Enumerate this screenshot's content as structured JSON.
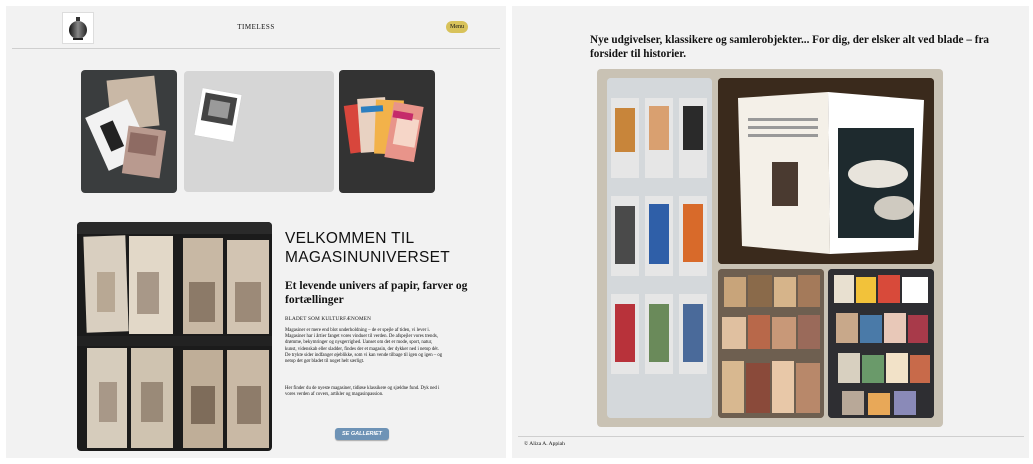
{
  "header": {
    "site_title": "TIMELESS",
    "menu_label": "Menu",
    "logo_icon": "vase-icon"
  },
  "intro": {
    "title": "VELKOMMEN TIL MAGASINUNIVERSET",
    "subtitle": "Et levende univers af papir, farver og fortællinger",
    "kicker": "BLADET SOM KULTURFÆNOMEN",
    "body1": "Magasiner er mere end blot underholdning – de er spejle af tiden, vi lever i. Magasiner har i årtier fanget vores vinduer til verden. De afspejler vores trends, drømme, bekymringer og nysgerrighed. Uanset om det er mode, sport, natur, kunst, videnskab eller sladder, findes der et magasin, der dykker ned i netop dét. De trykte sider indfanger øjeblikke, som vi kan vende tilbage til igen og igen – og netop det gør bladet til noget helt særligt.",
    "body2": "Her finder du de nyeste magasiner, tidløse klassikere og sjældne fund. Dyk ned i vores verden af covers, artikler og magasinpassion.",
    "gallery_button": "SE GALLERIET"
  },
  "right": {
    "tagline": "Nye udgivelser, klassikere og samlerobjekter... For dig, der elsker alt ved blade – fra forsider til historier.",
    "copyright": "© Aliza A. Appiah"
  },
  "colors": {
    "accent_button": "#d8c25a",
    "gallery_button": "#6e93b6",
    "panel_bg": "#f2f2f2"
  }
}
